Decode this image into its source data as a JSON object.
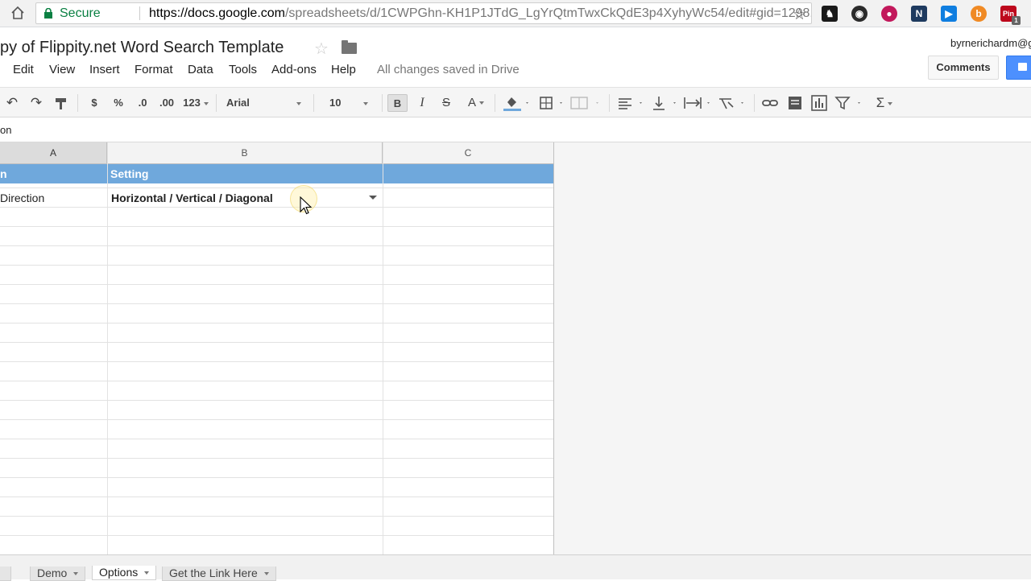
{
  "browser": {
    "secure_label": "Secure",
    "url_host": "https://docs.google.com",
    "url_path": "/spreadsheets/d/1CWPGhn-KH1P1JTdG_LgYrQtmTwxCkQdE3p4XyhyWc54/edit#gid=1298...",
    "extensions": [
      {
        "icon": "owl-extension-icon",
        "color": "#1a1a1a"
      },
      {
        "icon": "keep-extension-icon",
        "color": "#2b2b2b"
      },
      {
        "icon": "circle-extension-icon",
        "color": "#c2185b"
      },
      {
        "icon": "n-extension-icon",
        "color": "#1e3a5f"
      },
      {
        "icon": "screencast-extension-icon",
        "color": "#0f7ee0"
      },
      {
        "icon": "b-extension-icon",
        "color": "#f08a24"
      },
      {
        "icon": "pinterest-extension-icon",
        "color": "#bd081c"
      }
    ],
    "pin_badge": "1"
  },
  "doc": {
    "title": "py of Flippity.net Word Search Template",
    "user": "byrnerichardm@g",
    "comments_label": "Comments",
    "saved_status": "All changes saved in Drive"
  },
  "menu": [
    "Edit",
    "View",
    "Insert",
    "Format",
    "Data",
    "Tools",
    "Add-ons",
    "Help"
  ],
  "toolbar": {
    "currency": "$",
    "percent": "%",
    "decrease_decimal": ".0",
    "increase_decimal": ".00",
    "number_format": "123",
    "font": "Arial",
    "font_size": "10",
    "bold": "B",
    "italic": "I",
    "strike": "S",
    "text_color": "A",
    "sum": "Σ"
  },
  "formula_bar": {
    "content": "on"
  },
  "grid": {
    "columns": [
      "A",
      "B",
      "C"
    ],
    "header_row": [
      "n",
      "Setting",
      ""
    ],
    "row2": {
      "a": "Direction",
      "b": "Horizontal / Vertical / Diagonal"
    }
  },
  "sheets": [
    {
      "name": "Demo",
      "active": false
    },
    {
      "name": "Options",
      "active": true
    },
    {
      "name": "Get the Link Here",
      "active": false
    }
  ]
}
